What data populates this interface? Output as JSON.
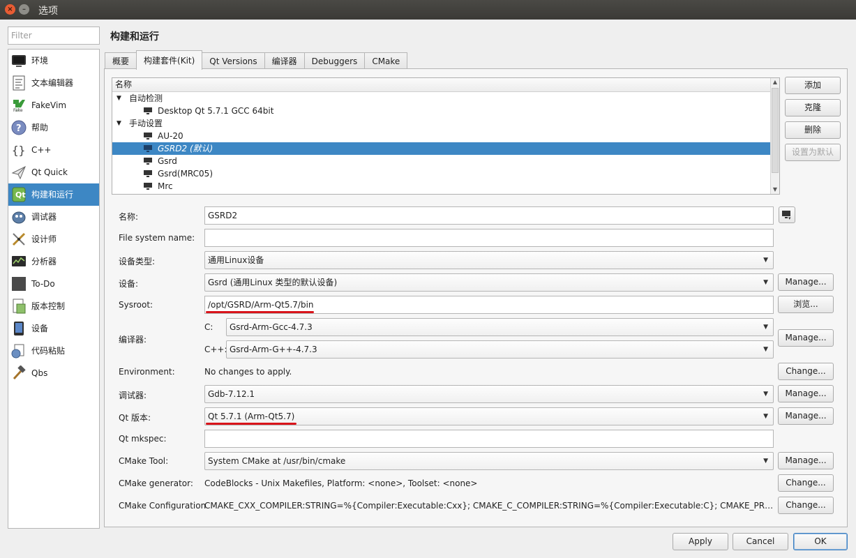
{
  "window": {
    "title": "选项"
  },
  "filter": {
    "placeholder": "Filter"
  },
  "sidebar": {
    "items": [
      {
        "label": "环境",
        "icon": "monitor-icon"
      },
      {
        "label": "文本编辑器",
        "icon": "text-editor-icon"
      },
      {
        "label": "FakeVim",
        "icon": "fakevim-icon"
      },
      {
        "label": "帮助",
        "icon": "help-icon"
      },
      {
        "label": "C++",
        "icon": "braces-icon"
      },
      {
        "label": "Qt Quick",
        "icon": "paper-plane-icon"
      },
      {
        "label": "构建和运行",
        "icon": "qt-build-icon",
        "selected": true
      },
      {
        "label": "调试器",
        "icon": "debugger-icon"
      },
      {
        "label": "设计师",
        "icon": "designer-icon"
      },
      {
        "label": "分析器",
        "icon": "analyzer-icon"
      },
      {
        "label": "To-Do",
        "icon": "todo-icon"
      },
      {
        "label": "版本控制",
        "icon": "version-control-icon"
      },
      {
        "label": "设备",
        "icon": "device-icon"
      },
      {
        "label": "代码粘贴",
        "icon": "code-paste-icon"
      },
      {
        "label": "Qbs",
        "icon": "hammer-icon"
      }
    ]
  },
  "page": {
    "heading": "构建和运行"
  },
  "tabs": [
    {
      "label": "概要"
    },
    {
      "label": "构建套件(Kit)",
      "active": true
    },
    {
      "label": "Qt Versions"
    },
    {
      "label": "编译器"
    },
    {
      "label": "Debuggers"
    },
    {
      "label": "CMake"
    }
  ],
  "tree": {
    "header": "名称",
    "groups": [
      {
        "label": "自动检测",
        "kits": [
          {
            "label": "Desktop Qt 5.7.1 GCC 64bit"
          }
        ]
      },
      {
        "label": "手动设置",
        "kits": [
          {
            "label": "AU-20"
          },
          {
            "label": "GSRD2 (默认)",
            "selected": true
          },
          {
            "label": "Gsrd"
          },
          {
            "label": "Gsrd(MRC05)"
          },
          {
            "label": "Mrc"
          }
        ]
      }
    ]
  },
  "side_buttons": {
    "add": "添加",
    "clone": "克隆",
    "remove": "删除",
    "make_default": "设置为默认"
  },
  "form": {
    "name": {
      "label": "名称:",
      "value": "GSRD2"
    },
    "fs_name": {
      "label": "File system name:",
      "value": ""
    },
    "device_type": {
      "label": "设备类型:",
      "value": "通用Linux设备"
    },
    "device": {
      "label": "设备:",
      "value": "Gsrd (通用Linux 类型的默认设备)",
      "button": "Manage..."
    },
    "sysroot": {
      "label": "Sysroot:",
      "value": "/opt/GSRD/Arm-Qt5.7/bin",
      "button": "浏览..."
    },
    "compiler": {
      "label": "编译器:",
      "c_label": "C:",
      "c_value": "Gsrd-Arm-Gcc-4.7.3",
      "cxx_label": "C++:",
      "cxx_value": "Gsrd-Arm-G++-4.7.3",
      "button": "Manage..."
    },
    "environment": {
      "label": "Environment:",
      "value": "No changes to apply.",
      "button": "Change..."
    },
    "debugger": {
      "label": "调试器:",
      "value": "Gdb-7.12.1",
      "button": "Manage..."
    },
    "qt_version": {
      "label": "Qt 版本:",
      "value": "Qt 5.7.1 (Arm-Qt5.7)",
      "button": "Manage..."
    },
    "qt_mkspec": {
      "label": "Qt mkspec:",
      "value": ""
    },
    "cmake_tool": {
      "label": "CMake Tool:",
      "value": "System CMake at /usr/bin/cmake",
      "button": "Manage..."
    },
    "cmake_generator": {
      "label": "CMake generator:",
      "value": "CodeBlocks - Unix Makefiles, Platform: <none>, Toolset: <none>",
      "button": "Change..."
    },
    "cmake_config": {
      "label": "CMake Configuration",
      "value": "CMAKE_CXX_COMPILER:STRING=%{Compiler:Executable:Cxx}; CMAKE_C_COMPILER:STRING=%{Compiler:Executable:C}; CMAKE_PREFIX_PATH:S…",
      "button": "Change..."
    }
  },
  "footer": {
    "apply": "Apply",
    "cancel": "Cancel",
    "ok": "OK"
  },
  "colors": {
    "selection": "#3d87c4",
    "annotation": "#d9141b"
  }
}
